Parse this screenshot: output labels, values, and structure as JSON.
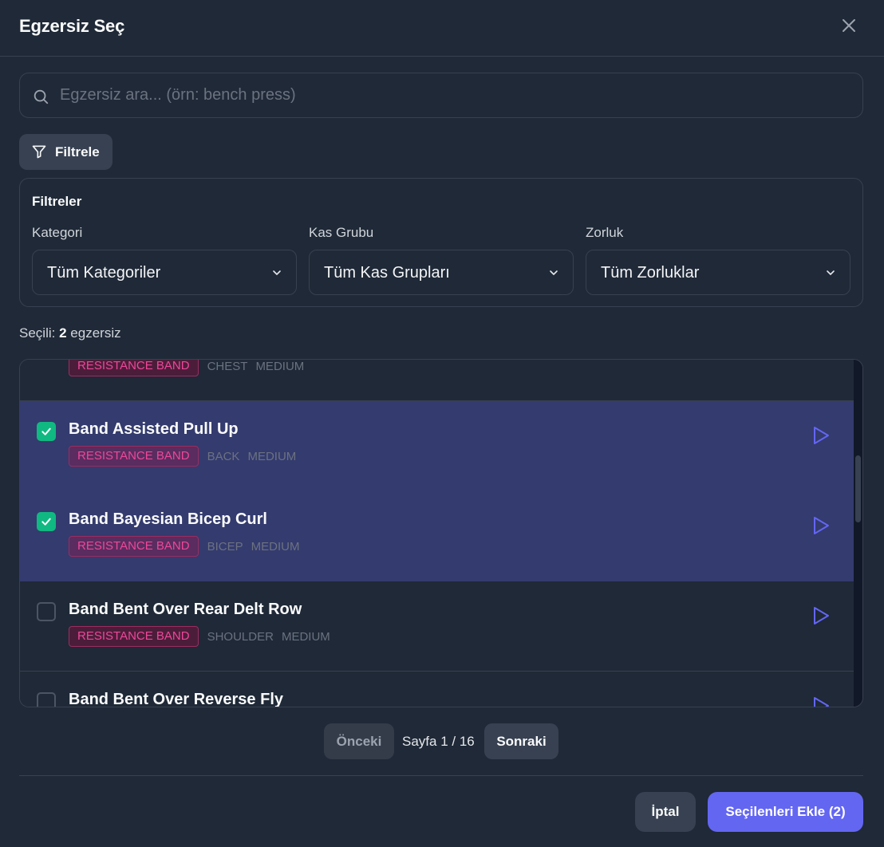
{
  "modal": {
    "title": "Egzersiz Seç"
  },
  "search": {
    "placeholder": "Egzersiz ara... (örn: bench press)",
    "value": ""
  },
  "filter_button": {
    "label": "Filtrele"
  },
  "filters": {
    "title": "Filtreler",
    "category": {
      "label": "Kategori",
      "value": "Tüm Kategoriler"
    },
    "muscle_group": {
      "label": "Kas Grubu",
      "value": "Tüm Kas Grupları"
    },
    "difficulty": {
      "label": "Zorluk",
      "value": "Tüm Zorluklar"
    }
  },
  "selected": {
    "prefix": "Seçili:",
    "count": "2",
    "suffix": "egzersiz"
  },
  "exercises": [
    {
      "name": "",
      "equipment": "RESISTANCE BAND",
      "muscle": "CHEST",
      "difficulty": "MEDIUM",
      "checked": false
    },
    {
      "name": "Band Assisted Pull Up",
      "equipment": "RESISTANCE BAND",
      "muscle": "BACK",
      "difficulty": "MEDIUM",
      "checked": true
    },
    {
      "name": "Band Bayesian Bicep Curl",
      "equipment": "RESISTANCE BAND",
      "muscle": "BICEP",
      "difficulty": "MEDIUM",
      "checked": true
    },
    {
      "name": "Band Bent Over Rear Delt Row",
      "equipment": "RESISTANCE BAND",
      "muscle": "SHOULDER",
      "difficulty": "MEDIUM",
      "checked": false
    },
    {
      "name": "Band Bent Over Reverse Fly",
      "equipment": "",
      "muscle": "",
      "difficulty": "",
      "checked": false
    }
  ],
  "pagination": {
    "prev_label": "Önceki",
    "page_info": "Sayfa 1 / 16",
    "next_label": "Sonraki"
  },
  "footer": {
    "cancel_label": "İptal",
    "add_label": "Seçilenleri Ekle (2)"
  },
  "colors": {
    "background": "#1f2937",
    "selected_row": "#343b6e",
    "accent": "#6366f1",
    "checkbox_on": "#10b981",
    "badge_text": "#ec4899"
  },
  "icons": {
    "close": "close-icon",
    "search": "search-icon",
    "filter": "filter-icon",
    "chevron": "chevron-down-icon",
    "check": "check-icon",
    "play": "play-icon"
  }
}
